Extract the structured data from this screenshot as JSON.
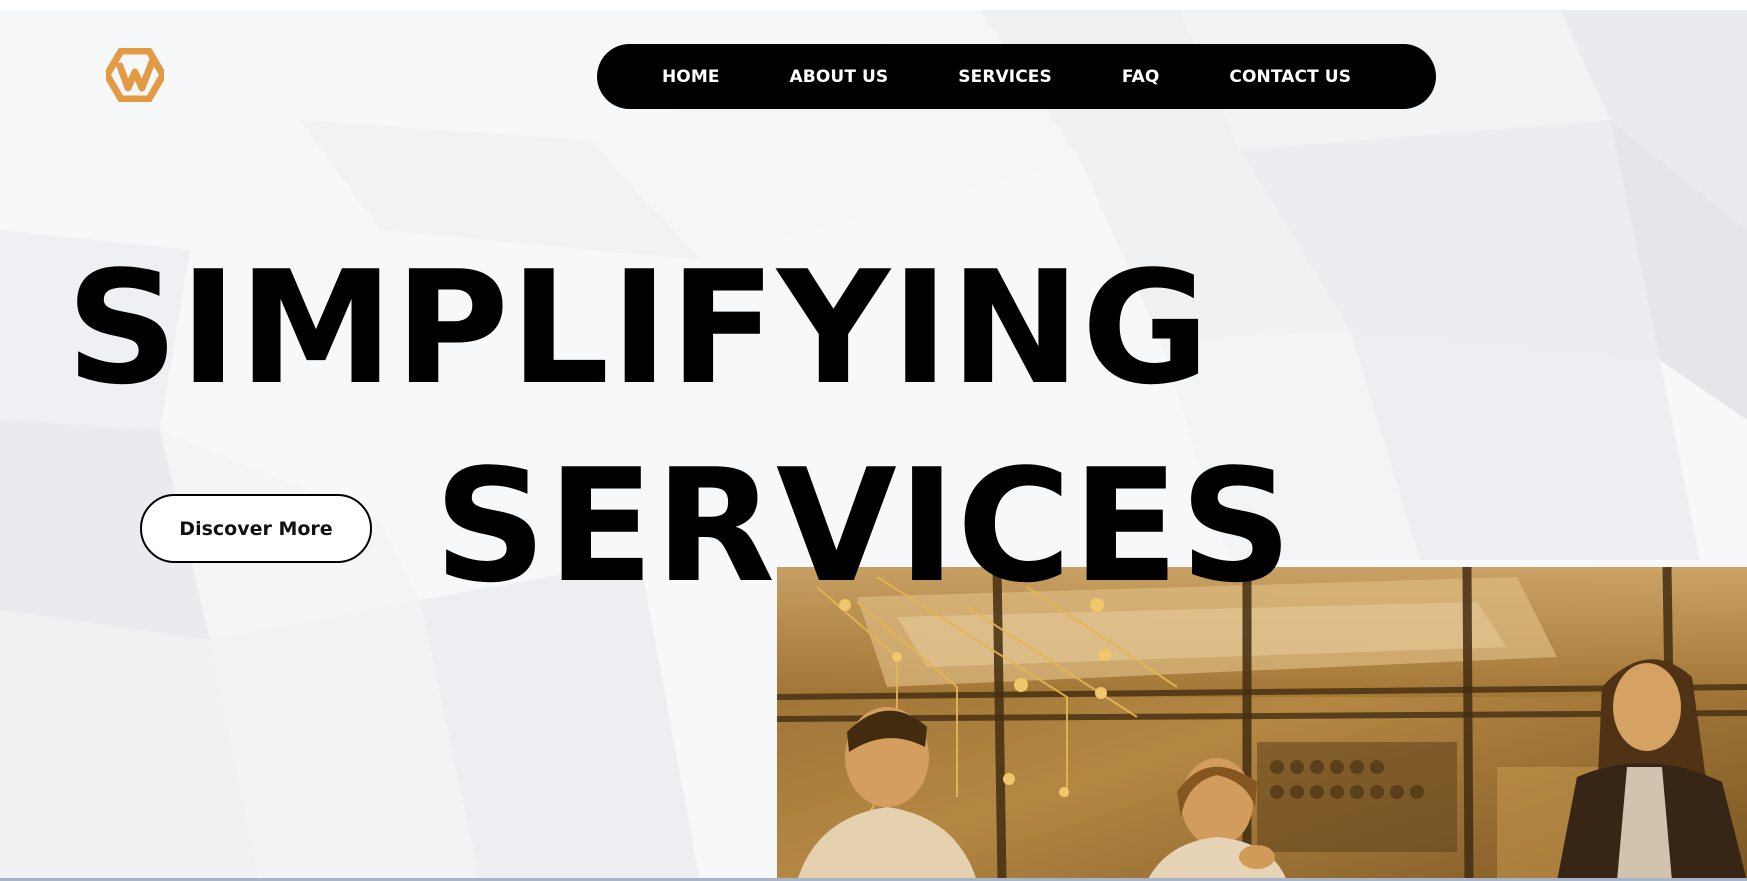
{
  "brand": {
    "logo_icon": "hexagon-w-logo-icon",
    "accent_color": "#E39A44"
  },
  "nav": {
    "items": [
      {
        "label": "HOME"
      },
      {
        "label": "ABOUT US"
      },
      {
        "label": "SERVICES"
      },
      {
        "label": "FAQ"
      },
      {
        "label": "CONTACT US"
      }
    ],
    "background_color": "#000000",
    "text_color": "#FFFFFF"
  },
  "hero": {
    "headline_line1": "SIMPLIFYING",
    "headline_line2": "SERVICES",
    "cta_label": "Discover More",
    "photo_description_icon": "office-team-photo"
  }
}
